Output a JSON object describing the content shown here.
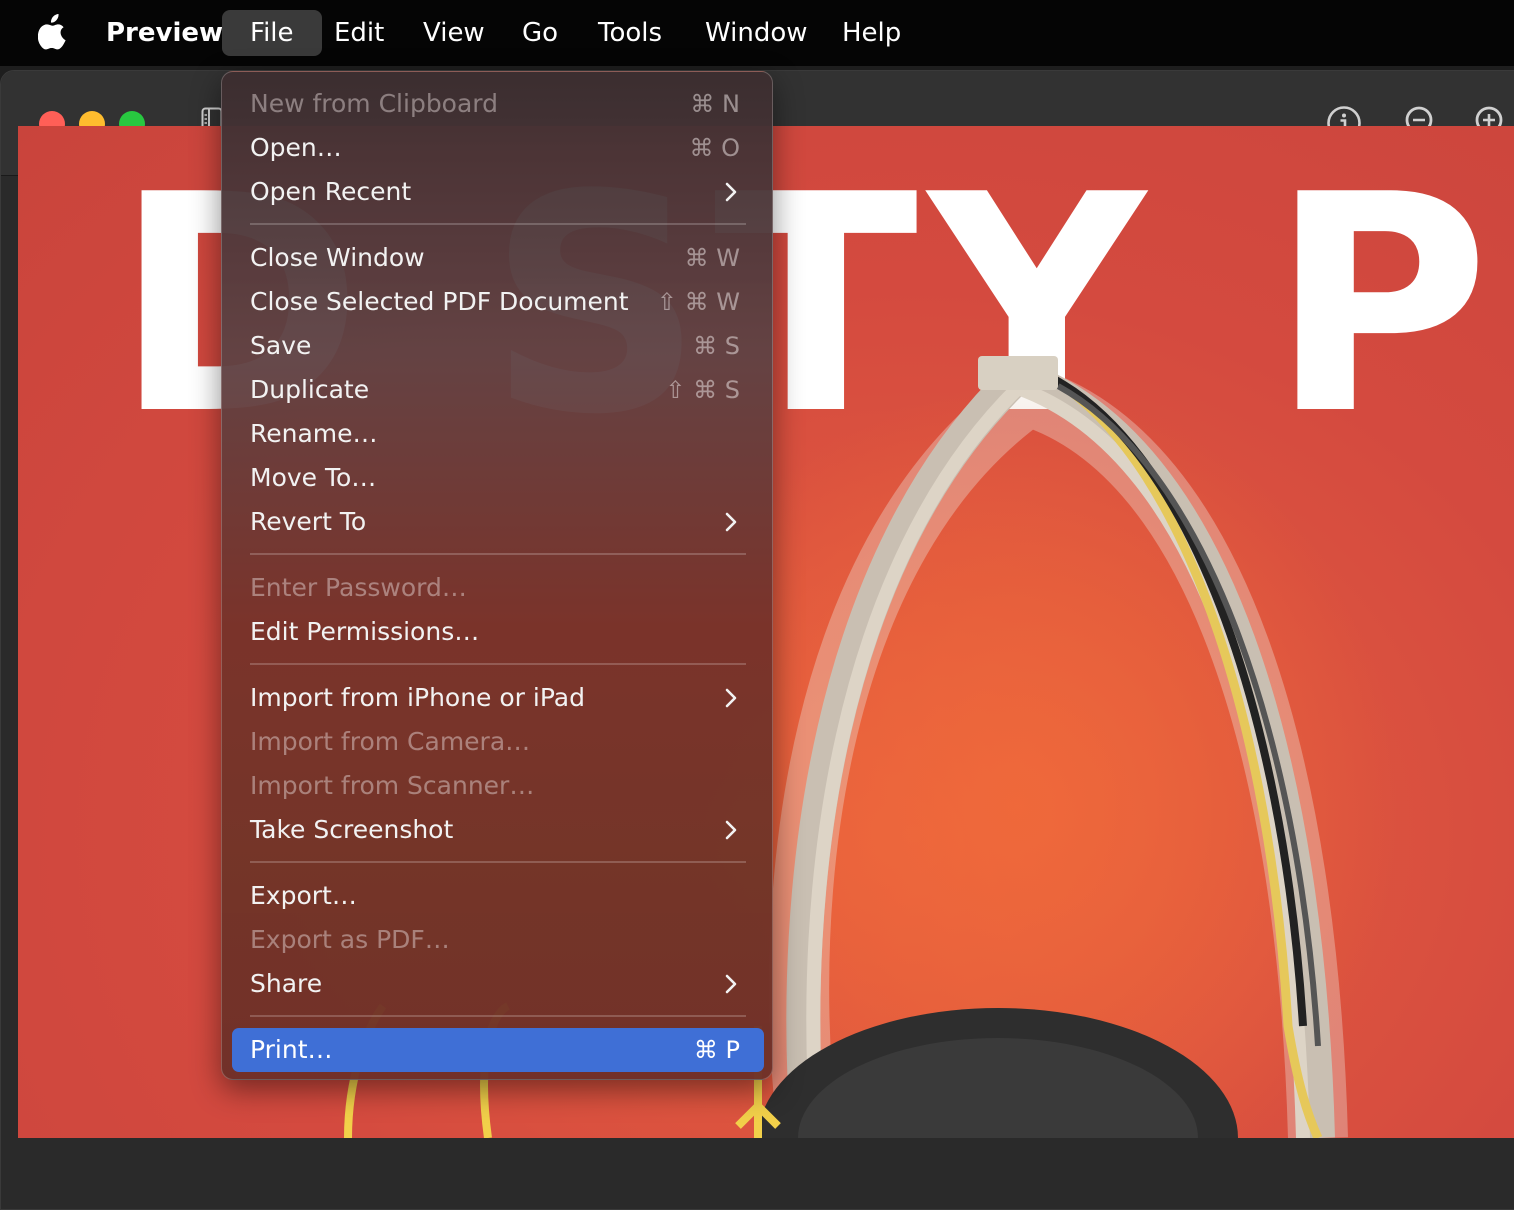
{
  "menubar": {
    "app_name": "Preview",
    "menus": [
      "File",
      "Edit",
      "View",
      "Go",
      "Tools",
      "Window",
      "Help"
    ],
    "active_menu": "File"
  },
  "document": {
    "headline": "D            STY PR"
  },
  "file_menu": {
    "items": [
      {
        "label": "New from Clipboard",
        "shortcut": "⌘ N",
        "disabled": true
      },
      {
        "label": "Open…",
        "shortcut": "⌘ O"
      },
      {
        "label": "Open Recent",
        "submenu": true
      },
      {
        "label": "Close Window",
        "shortcut": "⌘ W"
      },
      {
        "label": "Close Selected PDF Document",
        "shortcut": "⇧ ⌘ W"
      },
      {
        "label": "Save",
        "shortcut": "⌘ S"
      },
      {
        "label": "Duplicate",
        "shortcut": "⇧ ⌘ S"
      },
      {
        "label": "Rename…"
      },
      {
        "label": "Move To…"
      },
      {
        "label": "Revert To",
        "submenu": true
      },
      {
        "label": "Enter Password…",
        "disabled": true
      },
      {
        "label": "Edit Permissions…"
      },
      {
        "label": "Import from iPhone or iPad",
        "submenu": true
      },
      {
        "label": "Import from Camera…",
        "disabled": true
      },
      {
        "label": "Import from Scanner…",
        "disabled": true
      },
      {
        "label": "Take Screenshot",
        "submenu": true
      },
      {
        "label": "Export…"
      },
      {
        "label": "Export as PDF…",
        "disabled": true
      },
      {
        "label": "Share",
        "submenu": true
      },
      {
        "label": "Print…",
        "shortcut": "⌘ P",
        "selected": true
      }
    ]
  },
  "icons": {
    "toolbar": [
      "sidebar-toggle-icon",
      "info-icon",
      "zoom-out-icon",
      "zoom-in-icon"
    ],
    "menubar": [
      "apple-logo-icon"
    ]
  },
  "colors": {
    "selection": "#3f6fd6",
    "document_red": "#d44a3f",
    "traffic_close": "#ff5f57",
    "traffic_minimize": "#febc2e",
    "traffic_zoom": "#28c840"
  }
}
